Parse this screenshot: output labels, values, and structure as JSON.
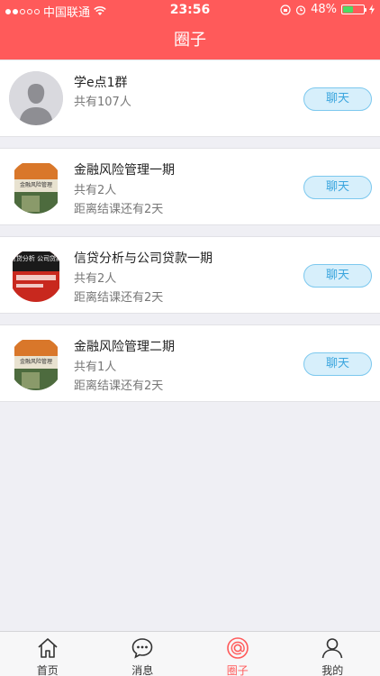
{
  "status_bar": {
    "carrier": "中国联通",
    "time": "23:56",
    "battery": "48%",
    "battery_level": 0.48
  },
  "header": {
    "title": "圈子"
  },
  "groups": [
    {
      "name": "学e点1群",
      "members": "共有107人",
      "countdown": "",
      "button": "聊天",
      "thumb": "default-avatar"
    },
    {
      "name": "金融风险管理一期",
      "members": "共有2人",
      "countdown": "距离结课还有2天",
      "button": "聊天",
      "thumb": "book-cover-finance"
    },
    {
      "name": "信贷分析与公司贷款一期",
      "members": "共有2人",
      "countdown": "距离结课还有2天",
      "button": "聊天",
      "thumb": "book-cover-credit"
    },
    {
      "name": "金融风险管理二期",
      "members": "共有1人",
      "countdown": "距离结课还有2天",
      "button": "聊天",
      "thumb": "book-cover-finance"
    }
  ],
  "book_titles": {
    "finance": "金融风险管理",
    "credit": "信贷分析 公司贷款"
  },
  "tabbar": [
    {
      "label": "首页",
      "icon": "home-icon"
    },
    {
      "label": "消息",
      "icon": "message-icon"
    },
    {
      "label": "圈子",
      "icon": "at-circle-icon",
      "active": true
    },
    {
      "label": "我的",
      "icon": "user-icon"
    }
  ],
  "colors": {
    "brand": "#ff5a5a",
    "chat_button_bg": "#d7effb",
    "chat_button_text": "#3aa5de",
    "battery": "#4cd964"
  }
}
